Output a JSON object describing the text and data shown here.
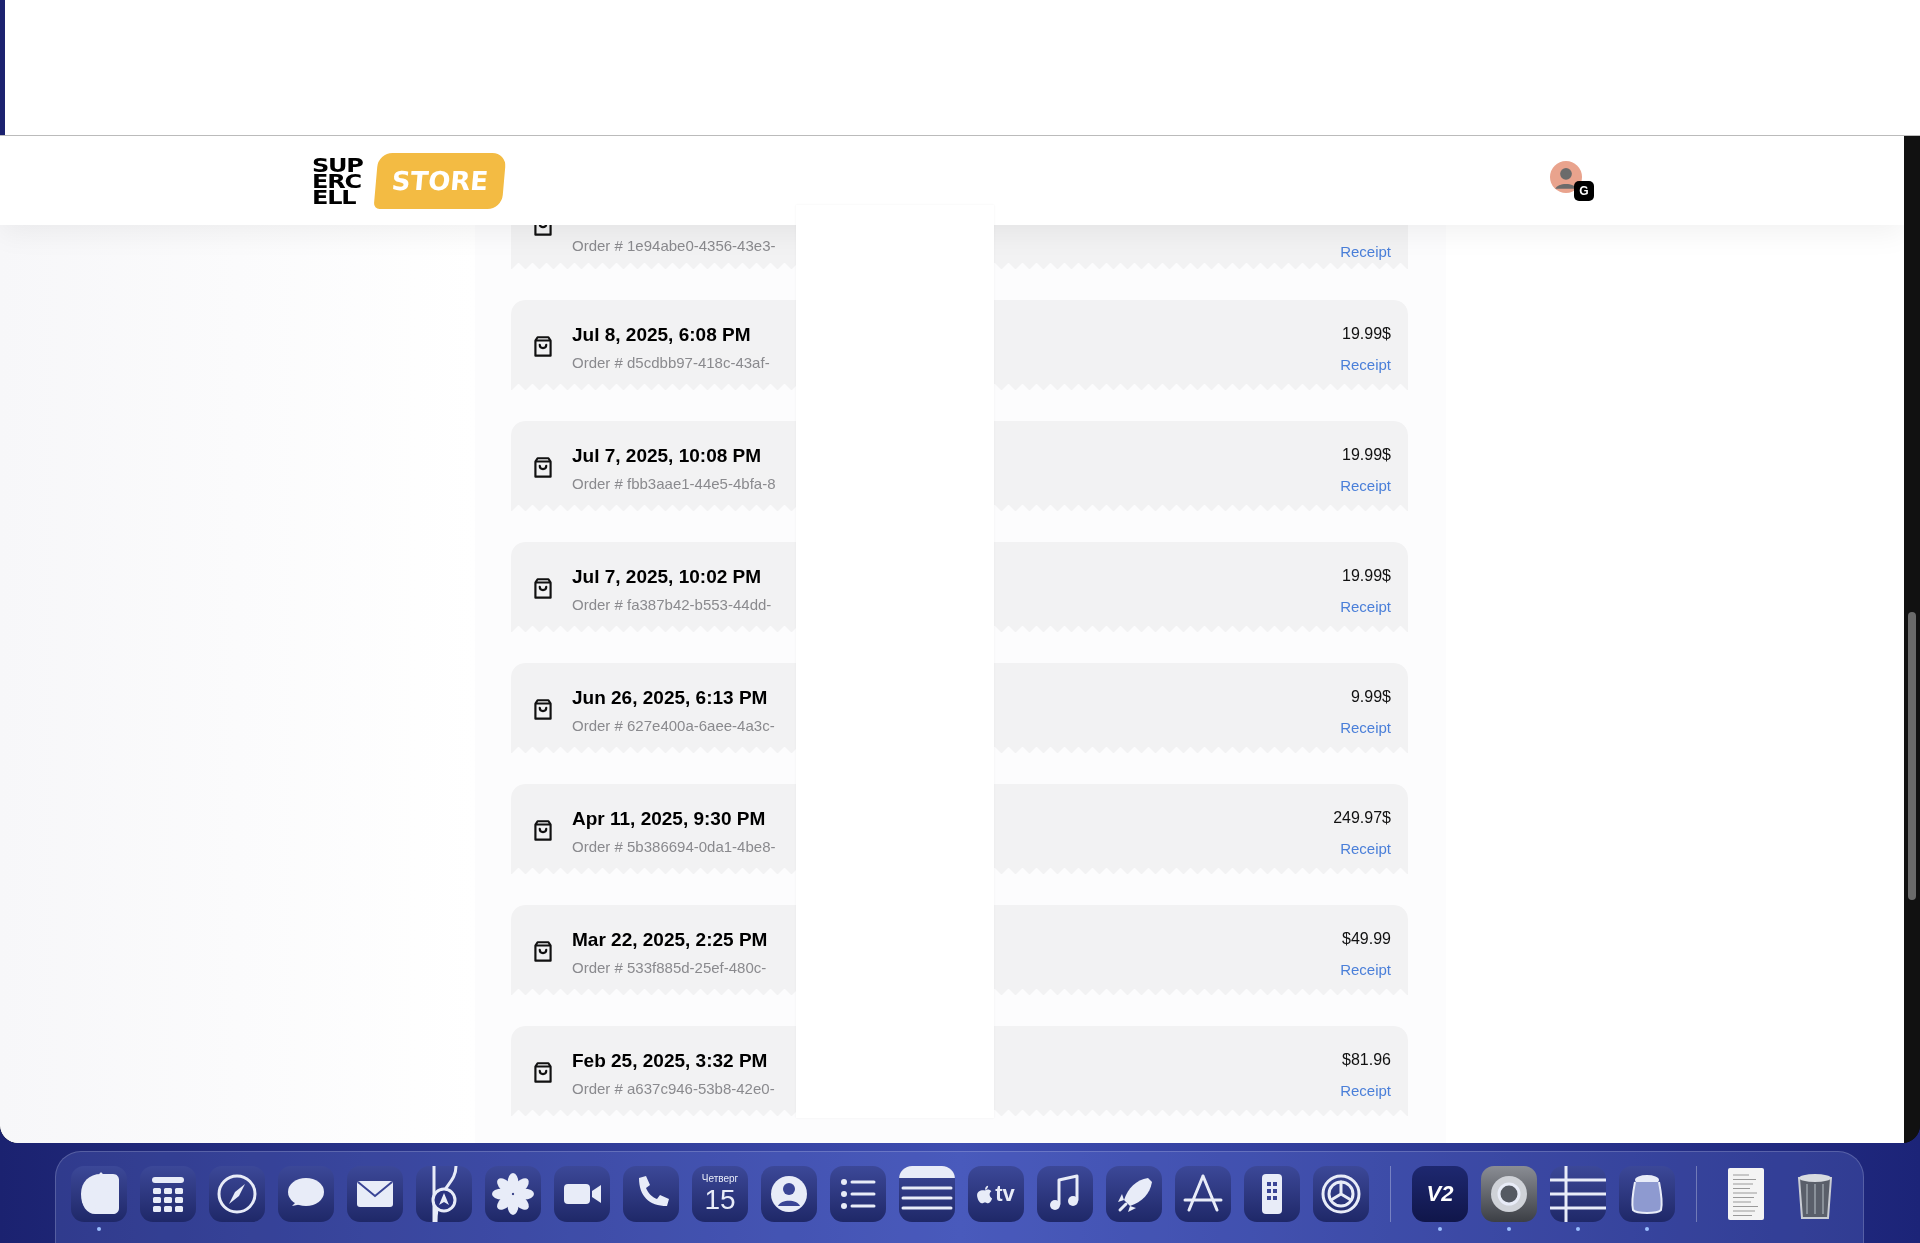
{
  "header": {
    "logo_lines": [
      "SUP",
      "ERC",
      "ELL"
    ],
    "store_label": "STORE",
    "account_badge": "G"
  },
  "orders": [
    {
      "order": "Order # 1e94abe0-4356-43e3-",
      "receipt": "Receipt"
    },
    {
      "date": "Jul 8, 2025, 6:08 PM",
      "order": "Order # d5cdbb97-418c-43af-",
      "price": "19.99$",
      "receipt": "Receipt"
    },
    {
      "date": "Jul 7, 2025, 10:08 PM",
      "order": "Order # fbb3aae1-44e5-4bfa-8",
      "price": "19.99$",
      "receipt": "Receipt"
    },
    {
      "date": "Jul 7, 2025, 10:02 PM",
      "order": "Order # fa387b42-b553-44dd-",
      "price": "19.99$",
      "receipt": "Receipt"
    },
    {
      "date": "Jun 26, 2025, 6:13 PM",
      "order": "Order # 627e400a-6aee-4a3c-",
      "price": "9.99$",
      "receipt": "Receipt"
    },
    {
      "date": "Apr 11, 2025, 9:30 PM",
      "order": "Order # 5b386694-0da1-4be8-",
      "price": "249.97$",
      "receipt": "Receipt"
    },
    {
      "date": "Mar 22, 2025, 2:25 PM",
      "order": "Order # 533f885d-25ef-480c-",
      "price": "$49.99",
      "receipt": "Receipt"
    },
    {
      "date": "Feb 25, 2025, 3:32 PM",
      "order": "Order # a637c946-53b8-42e0-",
      "price": "$81.96",
      "receipt": "Receipt"
    }
  ],
  "dock": [
    {
      "kind": "finder",
      "running": true
    },
    {
      "kind": "launchpad",
      "running": false
    },
    {
      "kind": "safari",
      "running": false
    },
    {
      "kind": "messages",
      "running": false
    },
    {
      "kind": "mail",
      "running": false
    },
    {
      "kind": "maps",
      "running": false
    },
    {
      "kind": "photos",
      "running": false
    },
    {
      "kind": "facetime",
      "running": false
    },
    {
      "kind": "phone",
      "running": false
    },
    {
      "kind": "calendar",
      "weekday": "Четверг",
      "day": "15",
      "running": false
    },
    {
      "kind": "contacts",
      "running": false
    },
    {
      "kind": "reminders",
      "running": false
    },
    {
      "kind": "notes",
      "running": false
    },
    {
      "kind": "tv",
      "label": "tv",
      "running": false
    },
    {
      "kind": "music",
      "running": false
    },
    {
      "kind": "rocket",
      "running": false
    },
    {
      "kind": "appstore",
      "running": false
    },
    {
      "kind": "simulator",
      "running": false
    },
    {
      "kind": "settings",
      "running": false
    },
    {
      "kind": "separator"
    },
    {
      "kind": "v2",
      "label": "V2",
      "running": true
    },
    {
      "kind": "chrome",
      "running": true
    },
    {
      "kind": "table",
      "running": true
    },
    {
      "kind": "jar",
      "running": true
    },
    {
      "kind": "separator"
    },
    {
      "kind": "document",
      "running": false
    },
    {
      "kind": "trash",
      "running": false
    }
  ]
}
